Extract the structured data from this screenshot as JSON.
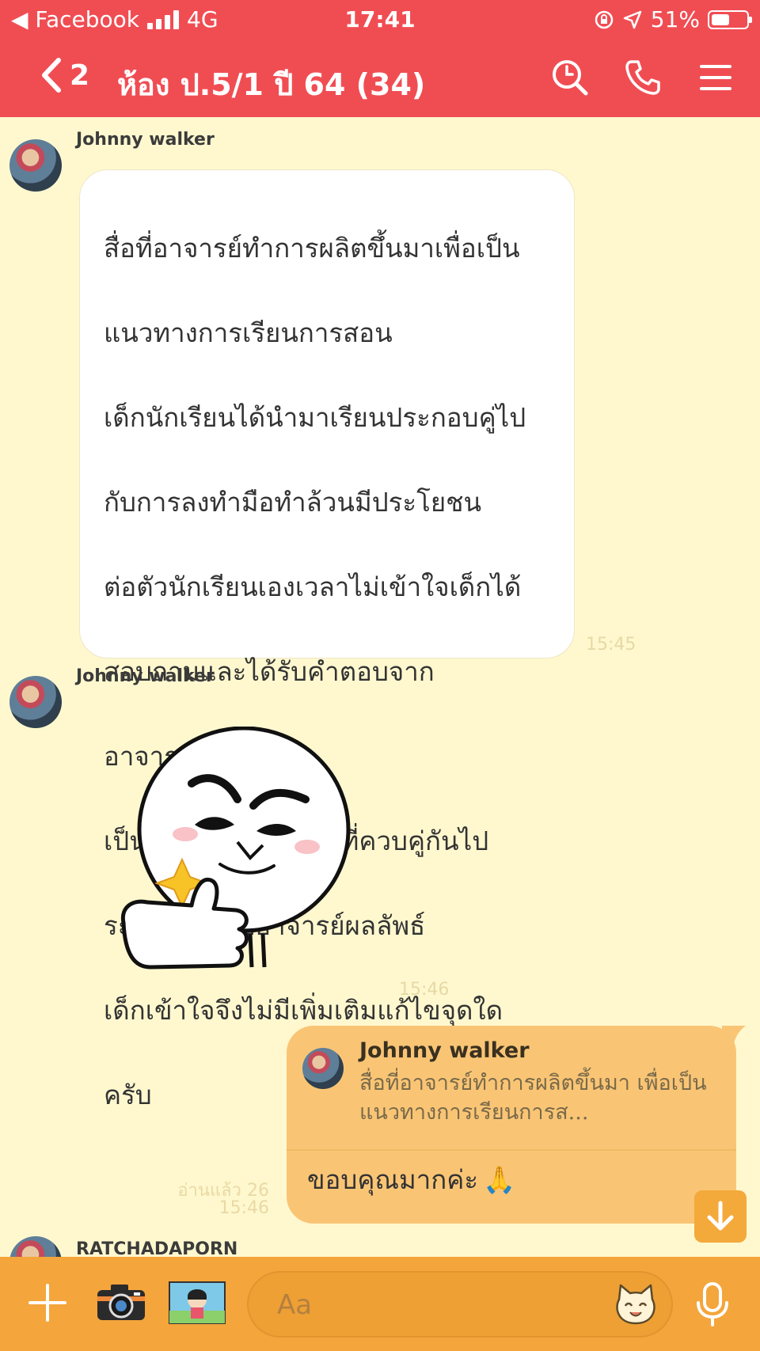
{
  "status_bar": {
    "back_app": "◀ Facebook",
    "network": "4G",
    "time": "17:41",
    "battery": "51%"
  },
  "header": {
    "back_count": "2",
    "title": "ห้อง ป.5/1 ปี 64 (34)"
  },
  "messages": {
    "m1": {
      "sender": "Johnny walker",
      "lines": [
        "สื่อที่อาจารย์ทำการผลิตขึ้นมาเพื่อเป็น",
        "แนวทางการเรียนการสอน",
        "เด็กนักเรียนได้นำมาเรียนประกอบคู่ไป",
        "กับการลงทำมือทำล้วนมีประโยชน",
        "ต่อตัวนักเรียนเองเวลาไม่เข้าใจเด็กได้",
        "สอบถามและได้รับคำตอบจาก",
        "อาจารย์ด้วยดี",
        "เป็นการเรียนการสอนที่ควบคู่กันไป",
        "ระหว่างสื่อกับอาจารย์ผลลัพธ์",
        "เด็กเข้าใจจึงไม่มีเพิ่มเติมแก้ไขจุดใด",
        "ครับ"
      ],
      "time": "15:45"
    },
    "m2": {
      "sender": "Johnny walker",
      "sticker": "thumbs-up-face-sticker",
      "time": "15:46"
    },
    "m3": {
      "quote_sender": "Johnny walker",
      "quote_text": "สื่อที่อาจารย์ทำการผลิตขึ้นมา เพื่อเป็นแนวทางการเรียนการส...",
      "text": "ขอบคุณมากค่ะ",
      "emoji": "🙏",
      "read": "อ่านแล้ว 26",
      "time": "15:46"
    },
    "m4": {
      "sender": "RATCHADAPORN"
    }
  },
  "input": {
    "placeholder": "Aa"
  },
  "colors": {
    "header_red": "#f04d53",
    "chat_bg": "#fff8cf",
    "own_bubble": "#f9c575",
    "bottom_bar": "#f4a53b"
  }
}
